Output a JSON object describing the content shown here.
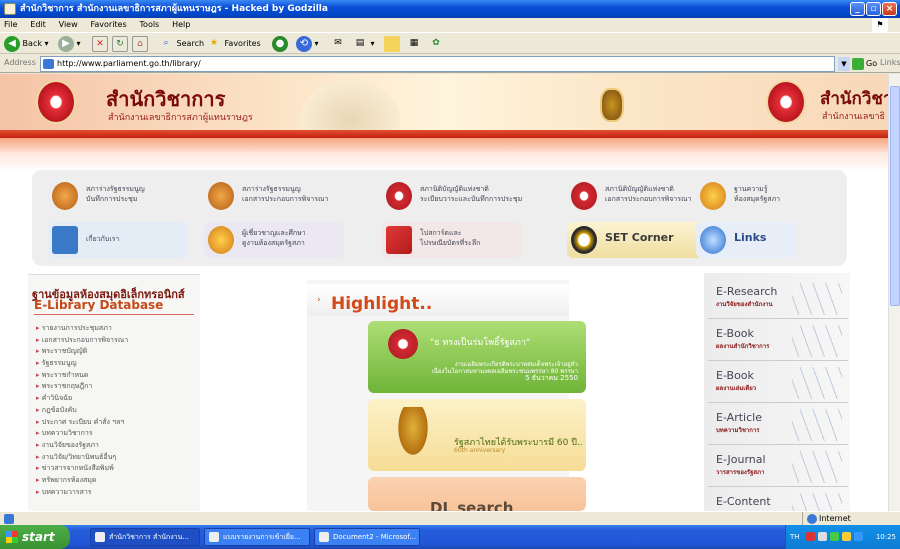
{
  "window": {
    "title": "สำนักวิชาการ สำนักงานเลขาธิการสภาผู้แทนราษฎร - Hacked by Godzilla"
  },
  "menubar": [
    "File",
    "Edit",
    "View",
    "Favorites",
    "Tools",
    "Help"
  ],
  "toolbar": {
    "back": "Back",
    "search": "Search",
    "favorites": "Favorites"
  },
  "address": {
    "label": "Address",
    "url": "http://www.parliament.go.th/library/",
    "go": "Go",
    "links": "Links"
  },
  "banner": {
    "title": "สำนักวิชาการ",
    "subtitle": "สำนักงานเลขาธิการสภาผู้แทนราษฎร",
    "title_right": "สำนักวิชา",
    "subtitle_right": "สำนักงานเลขาธิ"
  },
  "menu": [
    {
      "line1": "สภาร่างรัฐธรรมนูญ",
      "line2": "บันทึกการประชุม"
    },
    {
      "line1": "สภาร่างรัฐธรรมนูญ",
      "line2": "เอกสารประกอบการพิจารณา"
    },
    {
      "line1": "สภานิติบัญญัติแห่งชาติ",
      "line2": "ระเบียบวาระและบันทึกการประชุม"
    },
    {
      "line1": "สภานิติบัญญัติแห่งชาติ",
      "line2": "เอกสารประกอบการพิจารณา"
    },
    {
      "line1": "ฐานความรู้",
      "line2": "ห้องสมุดรัฐสภา"
    },
    {
      "line1": "เกี่ยวกับเรา",
      "line2": ""
    },
    {
      "line1": "ผู้เชี่ยวชาญและศึกษา",
      "line2": "ดูงานห้องสมุดรัฐสภา"
    },
    {
      "line1": "โปสการ์ดและ",
      "line2": "ไปรษณียบัตรที่ระลึก"
    },
    {
      "line1": "SET Corner",
      "line2": ""
    },
    {
      "line1": "Links",
      "line2": ""
    }
  ],
  "library": {
    "title_th": "ฐานข้อมูลห้องสมุดอิเล็กทรอนิกส์",
    "title_en": "E-Library Database",
    "items": [
      "รายงานการประชุมสภา",
      "เอกสารประกอบการพิจารณา",
      "พระราชบัญญัติ",
      "รัฐธรรมนูญ",
      "พระราชกำหนด",
      "พระราชกฤษฎีกา",
      "คำวินิจฉัย",
      "กฎข้อบังคับ",
      "ประกาศ ระเบียบ คำสั่ง ฯลฯ",
      "บทความวิชาการ",
      "งานวิจัยของรัฐสภา",
      "งานวิจัย/วิทยานิพนธ์อื่นๆ",
      "ข่าวสารจากหนังสือพิมพ์",
      "ทรัพยากรห้องสมุด",
      "บทความวารสาร"
    ]
  },
  "highlight": {
    "title": "Highlight..",
    "card1_title": "\"ธ ทรงเป็นร่มโพธิ์รัฐสภา\"",
    "card1_text": [
      "งานเฉลิมพระเกียรติพระบาทสมเด็จพระเจ้าอยู่หัว",
      "เนื่องในโอกาสมหามงคลเฉลิมพระชนมพรรษา 80 พรรษา",
      "5 ธันวาคม 2550"
    ],
    "card2_title": "รัฐสภาไทยได้รับพระบารมี 60 ปี..",
    "card2_sub": "60th anniversary",
    "card3_title": "DL search"
  },
  "eresources": [
    {
      "en": "E-Research",
      "th": "งานวิจัยของสำนักงาน"
    },
    {
      "en": "E-Book",
      "th": "ผลงานสำนักวิชาการ"
    },
    {
      "en": "E-Book",
      "th": "ผลงานเล่มเดียว"
    },
    {
      "en": "E-Article",
      "th": "บทความวิชาการ"
    },
    {
      "en": "E-Journal",
      "th": "วารสารของรัฐสภา"
    },
    {
      "en": "E-Content",
      "th": ""
    }
  ],
  "status": {
    "zone": "Internet"
  },
  "taskbar": {
    "start": "start",
    "tasks": [
      "สำนักวิชาการ สำนักงาน...",
      "แบบรายงานการเข้าเยี่ย...",
      "Document2 - Microsof..."
    ],
    "lang": "TH",
    "clock": "10:25"
  }
}
